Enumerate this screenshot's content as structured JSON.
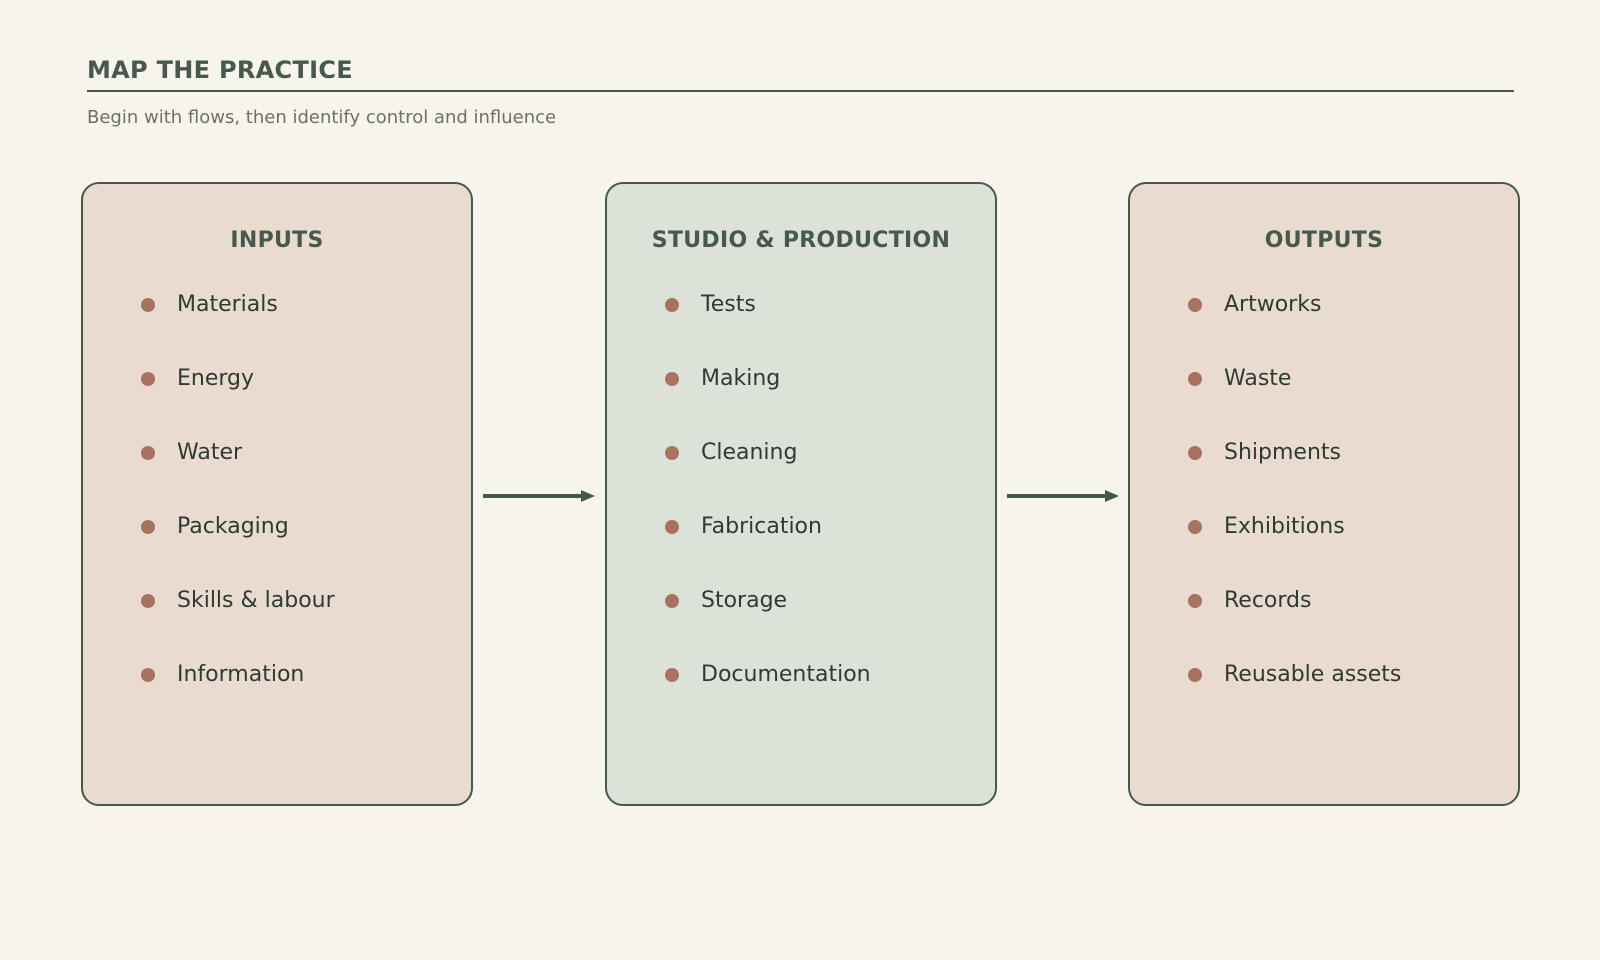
{
  "header": {
    "title": "MAP THE PRACTICE",
    "subtitle": "Begin with flows, then identify control and influence"
  },
  "colors": {
    "background": "#f7f4ec",
    "accent": "#46594c",
    "warm_panel": "#eadbd0",
    "cool_panel": "#dce2d8",
    "bullet": "#a7725f"
  },
  "boxes": [
    {
      "title": "INPUTS",
      "items": [
        "Materials",
        "Energy",
        "Water",
        "Packaging",
        "Skills & labour",
        "Information"
      ]
    },
    {
      "title": "STUDIO & PRODUCTION",
      "items": [
        "Tests",
        "Making",
        "Cleaning",
        "Fabrication",
        "Storage",
        "Documentation"
      ]
    },
    {
      "title": "OUTPUTS",
      "items": [
        "Artworks",
        "Waste",
        "Shipments",
        "Exhibitions",
        "Records",
        "Reusable assets"
      ]
    }
  ],
  "connectors": [
    {
      "from": "INPUTS",
      "to": "STUDIO & PRODUCTION",
      "icon": "arrow-right-icon"
    },
    {
      "from": "STUDIO & PRODUCTION",
      "to": "OUTPUTS",
      "icon": "arrow-right-icon"
    }
  ]
}
